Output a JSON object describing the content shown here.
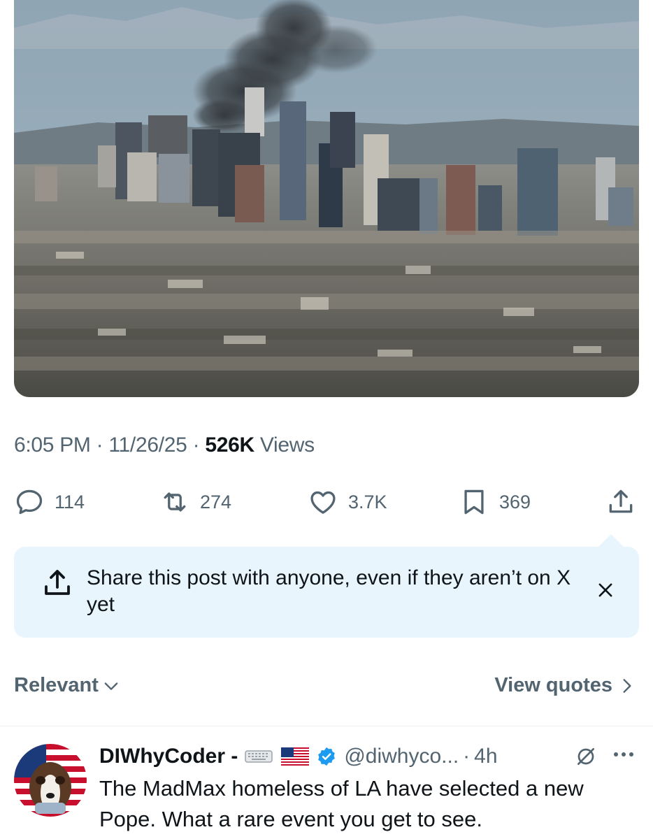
{
  "photo": {
    "description_icon": "city-skyline-with-smoke-photo"
  },
  "meta": {
    "time": "6:05 PM",
    "dot1": " · ",
    "date": "11/26/25",
    "dot2": " · ",
    "views_count": "526K",
    "views_label": " Views"
  },
  "actions": {
    "replies": "114",
    "reposts": "274",
    "likes": "3.7K",
    "bookmarks": "369"
  },
  "banner": {
    "text": "Share this post with anyone, even if they aren’t on X yet"
  },
  "sort": {
    "relevant_label": "Relevant",
    "view_quotes_label": "View quotes"
  },
  "reply": {
    "name": "DIWhyCoder -",
    "handle": "@diwhyco...",
    "separator": "·",
    "time": "4h",
    "text": "The MadMax homeless of LA have selected a new Pope. What a rare event you get to see."
  },
  "colors": {
    "accent_blue": "#1d9bf0",
    "secondary_text": "#536471",
    "banner_bg": "#e8f5fd"
  }
}
